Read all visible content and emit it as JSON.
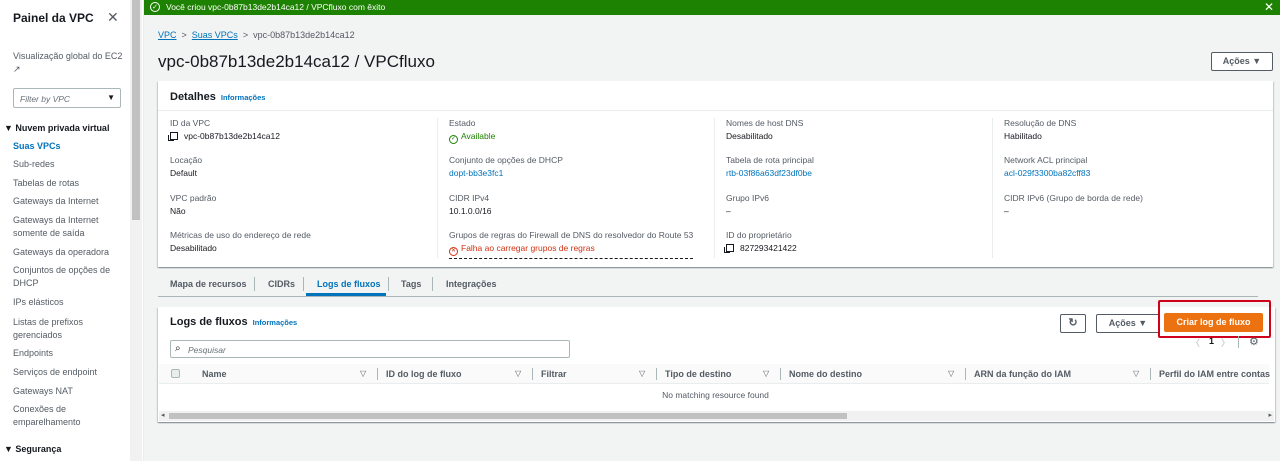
{
  "sidebar": {
    "title": "Painel da VPC",
    "close": "✕",
    "global_view": "Visualização global do EC2 ↗",
    "filter_placeholder": "Filter by VPC",
    "section_vpc": "▼ Nuvem privada virtual",
    "items": [
      "Suas VPCs",
      "Sub-redes",
      "Tabelas de rotas",
      "Gateways da Internet",
      "Gateways da Internet somente de saída",
      "Gateways da operadora",
      "Conjuntos de opções de DHCP",
      "IPs elásticos",
      "Listas de prefixos gerenciados",
      "Endpoints",
      "Serviços de endpoint",
      "Gateways NAT",
      "Conexões de emparelhamento"
    ],
    "section_security": "▼ Segurança"
  },
  "banner": {
    "message": "Você criou vpc-0b87b13de2b14ca12 / VPCfluxo com êxito",
    "close": "✕",
    "color": "#1d8102"
  },
  "breadcrumb": {
    "vpc": "VPC",
    "suas_vpcs": "Suas VPCs",
    "current": "vpc-0b87b13de2b14ca12",
    "sep": ">"
  },
  "page_title": "vpc-0b87b13de2b14ca12 / VPCfluxo",
  "actions_label": "Ações ▼",
  "details": {
    "title": "Detalhes",
    "info": "Informações",
    "fields": {
      "vpc_id": {
        "label": "ID da VPC",
        "value": "vpc-0b87b13de2b14ca12"
      },
      "state": {
        "label": "Estado",
        "value": "Available"
      },
      "dns_hostnames": {
        "label": "Nomes de host DNS",
        "value": "Desabilitado"
      },
      "dns_resolution": {
        "label": "Resolução de DNS",
        "value": "Habilitado"
      },
      "tenancy": {
        "label": "Locação",
        "value": "Default"
      },
      "dhcp": {
        "label": "Conjunto de opções de DHCP",
        "value": "dopt-bb3e3fc1"
      },
      "main_route": {
        "label": "Tabela de rota principal",
        "value": "rtb-03f86a63df23df0be"
      },
      "main_acl": {
        "label": "Network ACL principal",
        "value": "acl-029f3300ba82cff83"
      },
      "default_vpc": {
        "label": "VPC padrão",
        "value": "Não"
      },
      "cidr_ipv4": {
        "label": "CIDR IPv4",
        "value": "10.1.0.0/16"
      },
      "ipv6_pool": {
        "label": "Grupo IPv6",
        "value": "–"
      },
      "cidr_ipv6": {
        "label": "CIDR IPv6 (Grupo de borda de rede)",
        "value": "–"
      },
      "addr_metrics": {
        "label": "Métricas de uso do endereço de rede",
        "value": "Desabilitado"
      },
      "dns_firewall": {
        "label": "Grupos de regras do Firewall de DNS do resolvedor do Route 53",
        "value": "Falha ao carregar grupos de regras"
      },
      "owner": {
        "label": "ID do proprietário",
        "value": "827293421422"
      }
    }
  },
  "tabs": [
    "Mapa de recursos",
    "CIDRs",
    "Logs de fluxos",
    "Tags",
    "Integrações"
  ],
  "flow_logs": {
    "title": "Logs de fluxos",
    "info": "Informações",
    "refresh": "↻",
    "actions": "Ações ▼",
    "create": "Criar log de fluxo",
    "search_placeholder": "Pesquisar",
    "pager_prev": "〈",
    "pager_page": "1",
    "pager_next": "〉",
    "settings": "⚙",
    "columns": [
      "Name",
      "ID do log de fluxo",
      "Filtrar",
      "Tipo de destino",
      "Nome do destino",
      "ARN da função do IAM",
      "Perfil do IAM entre contas"
    ],
    "empty": "No matching resource found"
  }
}
